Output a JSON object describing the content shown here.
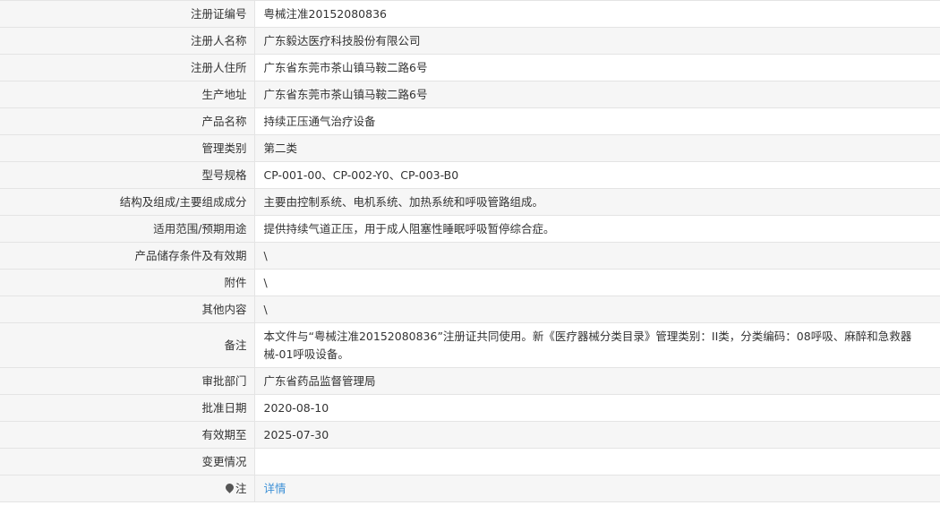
{
  "rows": [
    {
      "label": "注册证编号",
      "value": "粤械注准20152080836"
    },
    {
      "label": "注册人名称",
      "value": "广东毅达医疗科技股份有限公司"
    },
    {
      "label": "注册人住所",
      "value": "广东省东莞市茶山镇马鞍二路6号"
    },
    {
      "label": "生产地址",
      "value": "广东省东莞市茶山镇马鞍二路6号"
    },
    {
      "label": "产品名称",
      "value": "持续正压通气治疗设备"
    },
    {
      "label": "管理类别",
      "value": "第二类"
    },
    {
      "label": "型号规格",
      "value": "CP-001-00、CP-002-Y0、CP-003-B0"
    },
    {
      "label": "结构及组成/主要组成成分",
      "value": "主要由控制系统、电机系统、加热系统和呼吸管路组成。"
    },
    {
      "label": "适用范围/预期用途",
      "value": "提供持续气道正压，用于成人阻塞性睡眠呼吸暂停综合症。"
    },
    {
      "label": "产品储存条件及有效期",
      "value": "\\"
    },
    {
      "label": "附件",
      "value": "\\"
    },
    {
      "label": "其他内容",
      "value": "\\"
    },
    {
      "label": "备注",
      "value": "本文件与“粤械注准20152080836”注册证共同使用。新《医疗器械分类目录》管理类别：II类，分类编码：08呼吸、麻醉和急救器械-01呼吸设备。"
    },
    {
      "label": "审批部门",
      "value": "广东省药品监督管理局"
    },
    {
      "label": "批准日期",
      "value": "2020-08-10"
    },
    {
      "label": "有效期至",
      "value": "2025-07-30"
    },
    {
      "label": "变更情况",
      "value": ""
    }
  ],
  "note": {
    "icon": "pin-icon",
    "label": "注",
    "link_text": "详情",
    "link_color": "#3b8fd6"
  }
}
